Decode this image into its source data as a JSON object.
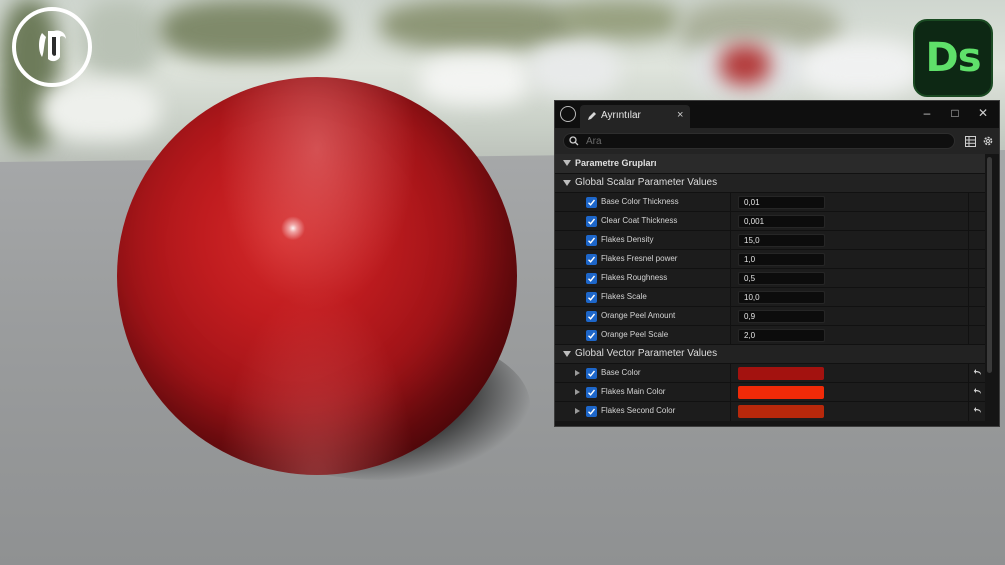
{
  "panel": {
    "tab_label": "Ayrıntılar",
    "tab_close": "×",
    "window_controls": {
      "minimize": "–",
      "maximize": "□",
      "close": "✕"
    },
    "search": {
      "placeholder": "Ara",
      "value": ""
    },
    "section_title": "Parametre Grupları",
    "scalar_group": {
      "title": "Global Scalar Parameter Values",
      "params": [
        {
          "name": "Base Color Thickness",
          "value": "0,01"
        },
        {
          "name": "Clear Coat Thickness",
          "value": "0,001"
        },
        {
          "name": "Flakes Density",
          "value": "15,0"
        },
        {
          "name": "Flakes Fresnel power",
          "value": "1,0"
        },
        {
          "name": "Flakes Roughness",
          "value": "0,5"
        },
        {
          "name": "Flakes Scale",
          "value": "10,0"
        },
        {
          "name": "Orange Peel Amount",
          "value": "0,9"
        },
        {
          "name": "Orange Peel Scale",
          "value": "2,0"
        }
      ]
    },
    "vector_group": {
      "title": "Global Vector Parameter Values",
      "params": [
        {
          "name": "Base Color",
          "color": "#a3120f"
        },
        {
          "name": "Flakes Main Color",
          "color": "#f12a08"
        },
        {
          "name": "Flakes Second Color",
          "color": "#b7280b"
        }
      ]
    }
  },
  "logos": {
    "ds_text": "Ds",
    "unreal_icon": "unreal-engine-icon"
  },
  "colors": {
    "checkbox": "#1d66c9",
    "panel_bg": "#151515",
    "ds_green": "#5fe06a"
  }
}
